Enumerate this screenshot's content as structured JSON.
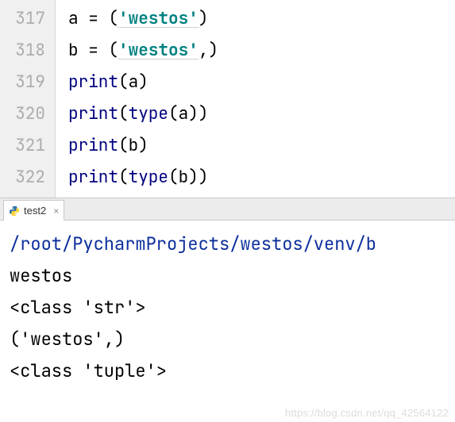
{
  "gutter": {
    "lines": [
      "317",
      "318",
      "319",
      "320",
      "321",
      "322"
    ]
  },
  "code": {
    "l1": {
      "var": "a",
      "eq": " = ",
      "op1": "(",
      "q1": "'",
      "s": "westos",
      "q2": "'",
      "op2": ")"
    },
    "l2": {
      "var": "b",
      "eq": " = ",
      "op1": "(",
      "q1": "'",
      "s": "westos",
      "q2": "'",
      "comma": ",",
      "op2": ")"
    },
    "l3": {
      "fn": "print",
      "op1": "(",
      "arg": "a",
      "op2": ")"
    },
    "l4": {
      "fn": "print",
      "op1": "(",
      "bi": "type",
      "op2": "(",
      "arg": "a",
      "op3": ")",
      "op4": ")"
    },
    "l5": {
      "fn": "print",
      "op1": "(",
      "arg": "b",
      "op2": ")"
    },
    "l6": {
      "fn": "print",
      "op1": "(",
      "bi": "type",
      "op2": "(",
      "arg": "b",
      "op3": ")",
      "op4": ")"
    }
  },
  "tab": {
    "label": "test2"
  },
  "console": {
    "path": "/root/PycharmProjects/westos/venv/b",
    "out1": "westos",
    "out2": "<class 'str'>",
    "out3": "('westos',)",
    "out4": "<class 'tuple'>"
  },
  "watermark": "https://blog.csdn.net/qq_42564122"
}
